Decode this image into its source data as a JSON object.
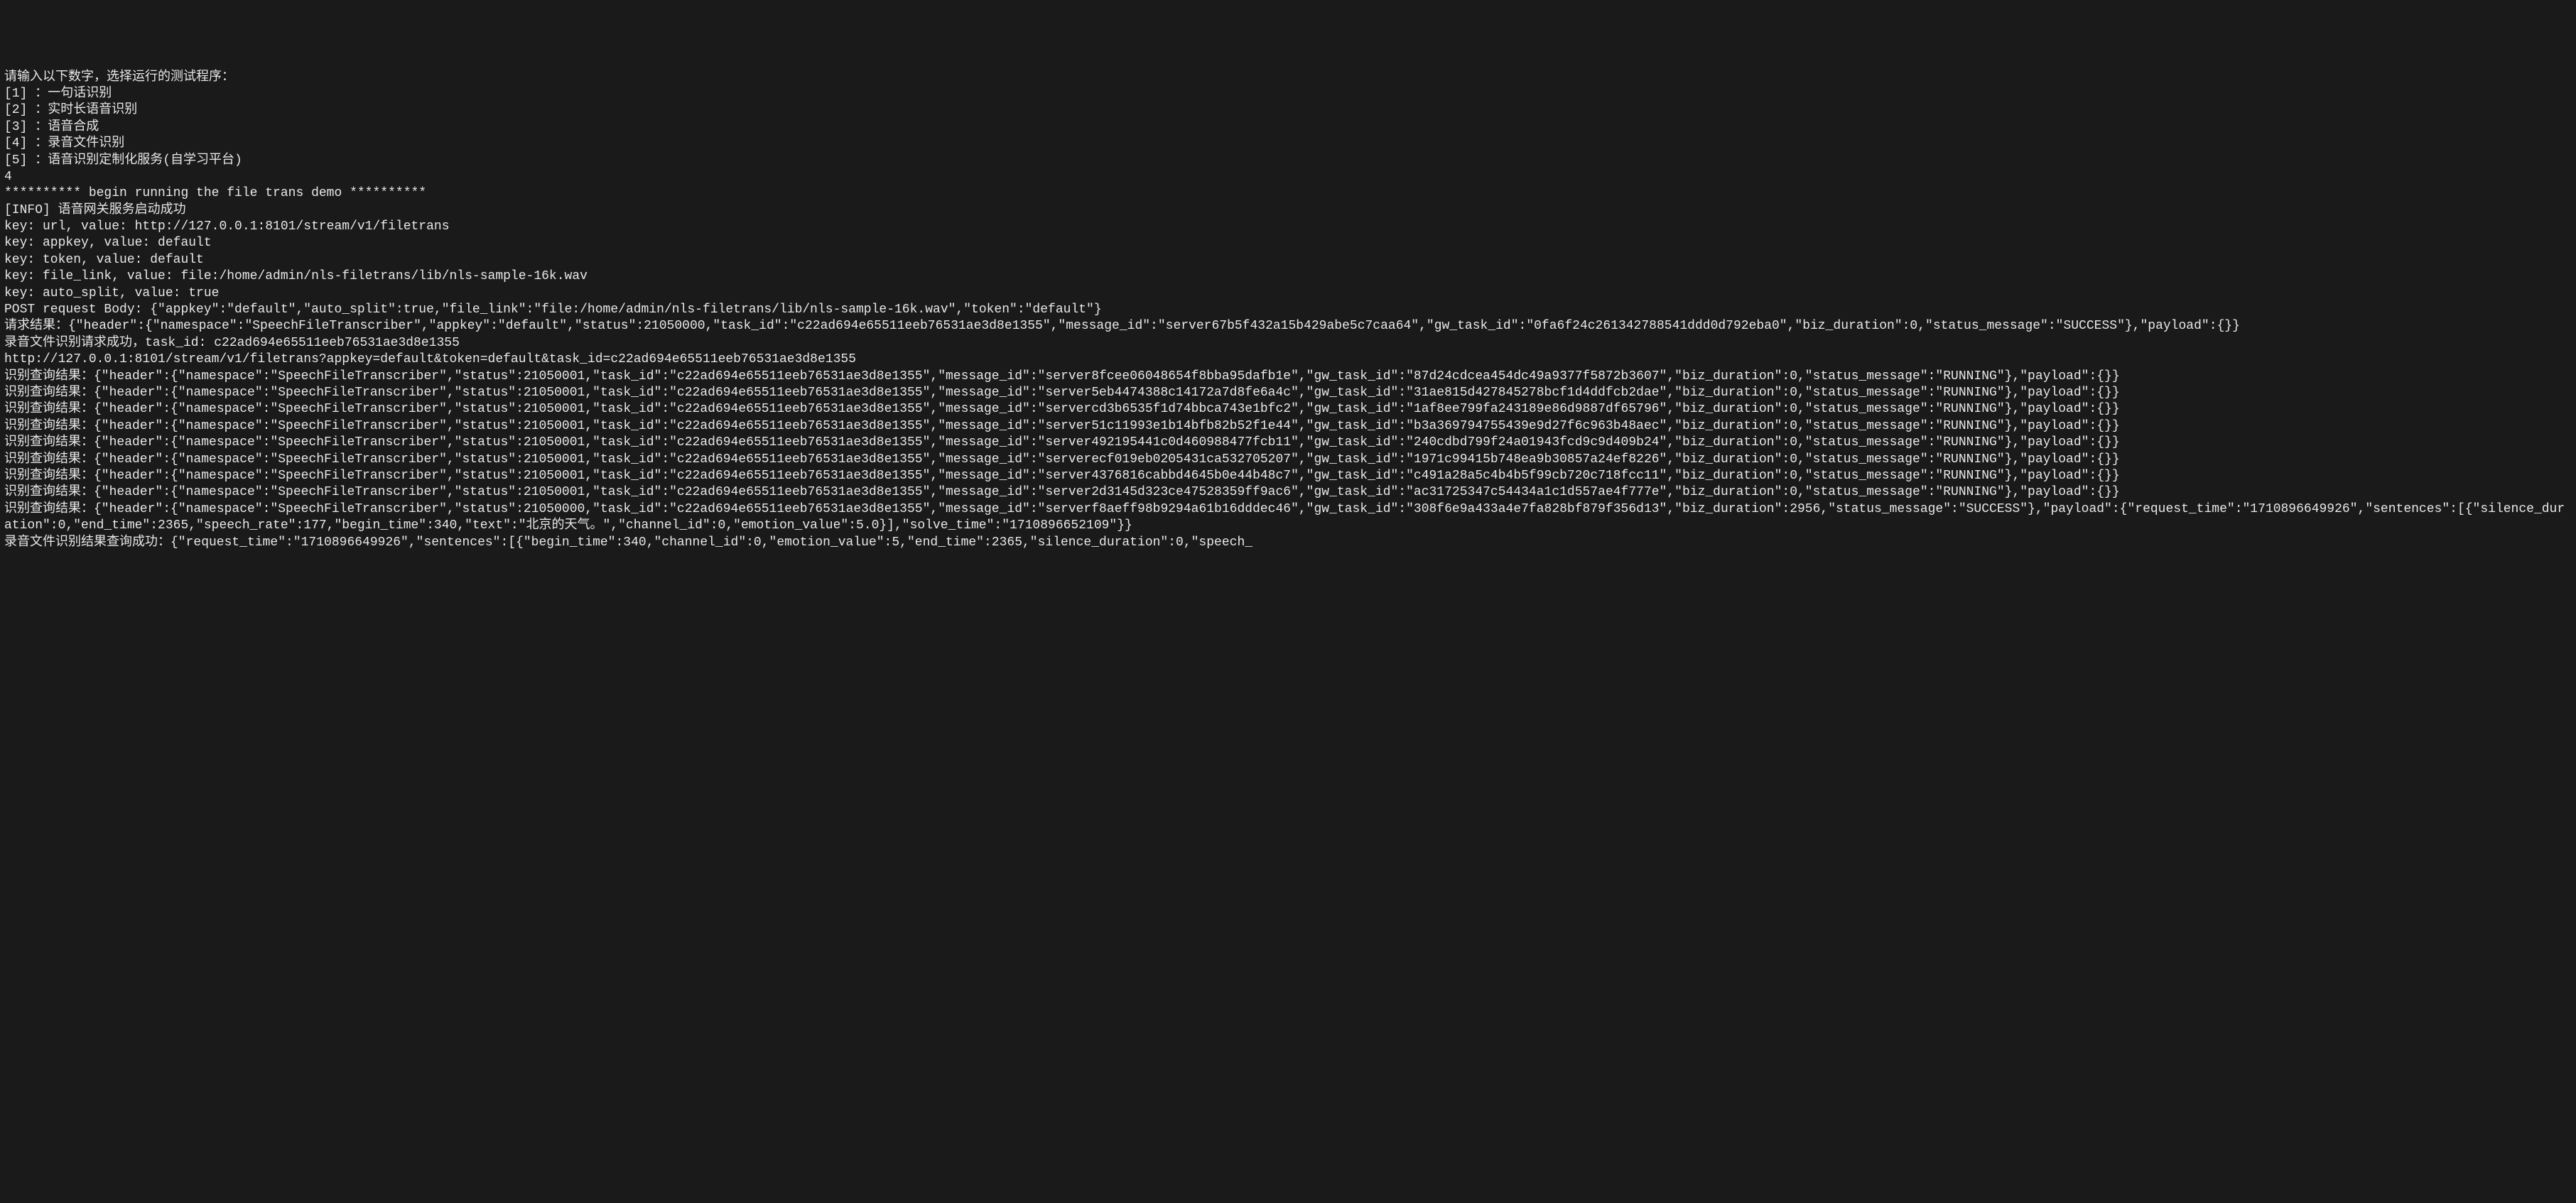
{
  "terminal": {
    "lines": [
      "请输入以下数字，选择运行的测试程序：",
      "[1] ：一句话识别",
      "[2] ：实时长语音识别",
      "[3] ：语音合成",
      "[4] ：录音文件识别",
      "[5] ：语音识别定制化服务(自学习平台)",
      "4",
      "********** begin running the file trans demo **********",
      "[INFO] 语音网关服务启动成功",
      "key: url, value: http://127.0.0.1:8101/stream/v1/filetrans",
      "key: appkey, value: default",
      "key: token, value: default",
      "key: file_link, value: file:/home/admin/nls-filetrans/lib/nls-sample-16k.wav",
      "key: auto_split, value: true",
      "POST request Body: {\"appkey\":\"default\",\"auto_split\":true,\"file_link\":\"file:/home/admin/nls-filetrans/lib/nls-sample-16k.wav\",\"token\":\"default\"}",
      "",
      "请求结果：{\"header\":{\"namespace\":\"SpeechFileTranscriber\",\"appkey\":\"default\",\"status\":21050000,\"task_id\":\"c22ad694e65511eeb76531ae3d8e1355\",\"message_id\":\"server67b5f432a15b429abe5c7caa64\",\"gw_task_id\":\"0fa6f24c261342788541ddd0d792eba0\",\"biz_duration\":0,\"status_message\":\"SUCCESS\"},\"payload\":{}}",
      "录音文件识别请求成功，task_id: c22ad694e65511eeb76531ae3d8e1355",
      "http://127.0.0.1:8101/stream/v1/filetrans?appkey=default&token=default&task_id=c22ad694e65511eeb76531ae3d8e1355",
      "识别查询结果：{\"header\":{\"namespace\":\"SpeechFileTranscriber\",\"status\":21050001,\"task_id\":\"c22ad694e65511eeb76531ae3d8e1355\",\"message_id\":\"server8fcee06048654f8bba95dafb1e\",\"gw_task_id\":\"87d24cdcea454dc49a9377f5872b3607\",\"biz_duration\":0,\"status_message\":\"RUNNING\"},\"payload\":{}}",
      "识别查询结果：{\"header\":{\"namespace\":\"SpeechFileTranscriber\",\"status\":21050001,\"task_id\":\"c22ad694e65511eeb76531ae3d8e1355\",\"message_id\":\"server5eb4474388c14172a7d8fe6a4c\",\"gw_task_id\":\"31ae815d427845278bcf1d4ddfcb2dae\",\"biz_duration\":0,\"status_message\":\"RUNNING\"},\"payload\":{}}",
      "识别查询结果：{\"header\":{\"namespace\":\"SpeechFileTranscriber\",\"status\":21050001,\"task_id\":\"c22ad694e65511eeb76531ae3d8e1355\",\"message_id\":\"servercd3b6535f1d74bbca743e1bfc2\",\"gw_task_id\":\"1af8ee799fa243189e86d9887df65796\",\"biz_duration\":0,\"status_message\":\"RUNNING\"},\"payload\":{}}",
      "识别查询结果：{\"header\":{\"namespace\":\"SpeechFileTranscriber\",\"status\":21050001,\"task_id\":\"c22ad694e65511eeb76531ae3d8e1355\",\"message_id\":\"server51c11993e1b14bfb82b52f1e44\",\"gw_task_id\":\"b3a369794755439e9d27f6c963b48aec\",\"biz_duration\":0,\"status_message\":\"RUNNING\"},\"payload\":{}}",
      "识别查询结果：{\"header\":{\"namespace\":\"SpeechFileTranscriber\",\"status\":21050001,\"task_id\":\"c22ad694e65511eeb76531ae3d8e1355\",\"message_id\":\"server492195441c0d460988477fcb11\",\"gw_task_id\":\"240cdbd799f24a01943fcd9c9d409b24\",\"biz_duration\":0,\"status_message\":\"RUNNING\"},\"payload\":{}}",
      "识别查询结果：{\"header\":{\"namespace\":\"SpeechFileTranscriber\",\"status\":21050001,\"task_id\":\"c22ad694e65511eeb76531ae3d8e1355\",\"message_id\":\"serverecf019eb0205431ca532705207\",\"gw_task_id\":\"1971c99415b748ea9b30857a24ef8226\",\"biz_duration\":0,\"status_message\":\"RUNNING\"},\"payload\":{}}",
      "识别查询结果：{\"header\":{\"namespace\":\"SpeechFileTranscriber\",\"status\":21050001,\"task_id\":\"c22ad694e65511eeb76531ae3d8e1355\",\"message_id\":\"server4376816cabbd4645b0e44b48c7\",\"gw_task_id\":\"c491a28a5c4b4b5f99cb720c718fcc11\",\"biz_duration\":0,\"status_message\":\"RUNNING\"},\"payload\":{}}",
      "识别查询结果：{\"header\":{\"namespace\":\"SpeechFileTranscriber\",\"status\":21050001,\"task_id\":\"c22ad694e65511eeb76531ae3d8e1355\",\"message_id\":\"server2d3145d323ce47528359ff9ac6\",\"gw_task_id\":\"ac31725347c54434a1c1d557ae4f777e\",\"biz_duration\":0,\"status_message\":\"RUNNING\"},\"payload\":{}}",
      "识别查询结果：{\"header\":{\"namespace\":\"SpeechFileTranscriber\",\"status\":21050000,\"task_id\":\"c22ad694e65511eeb76531ae3d8e1355\",\"message_id\":\"serverf8aeff98b9294a61b16dddec46\",\"gw_task_id\":\"308f6e9a433a4e7fa828bf879f356d13\",\"biz_duration\":2956,\"status_message\":\"SUCCESS\"},\"payload\":{\"request_time\":\"1710896649926\",\"sentences\":[{\"silence_duration\":0,\"end_time\":2365,\"speech_rate\":177,\"begin_time\":340,\"text\":\"北京的天气。\",\"channel_id\":0,\"emotion_value\":5.0}],\"solve_time\":\"1710896652109\"}}",
      "录音文件识别结果查询成功：{\"request_time\":\"1710896649926\",\"sentences\":[{\"begin_time\":340,\"channel_id\":0,\"emotion_value\":5,\"end_time\":2365,\"silence_duration\":0,\"speech_"
    ]
  }
}
